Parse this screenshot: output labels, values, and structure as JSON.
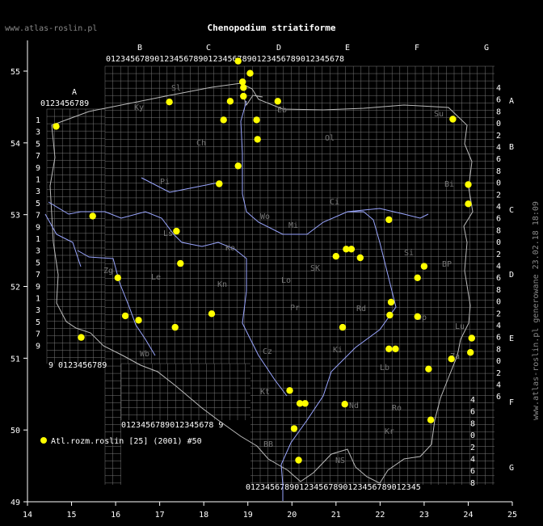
{
  "site_label": "www.atlas-roslin.pl",
  "title": "Chenopodium striatiforme",
  "generated": "www.atlas-roslin.pl generowane 23.02.18 18:09",
  "legend": {
    "label": "Atl.rozm.roslin [25] (2001) #50",
    "color": "#ffff00"
  },
  "colors": {
    "background": "#000000",
    "grid": "#777777",
    "border": "#bbbbbb",
    "rivers": "#9aa6ff",
    "points": "#ffff00"
  },
  "axes": {
    "lon_ticks": [
      "14",
      "15",
      "16",
      "17",
      "18",
      "19",
      "20",
      "21",
      "22",
      "23",
      "24",
      "25"
    ],
    "lat_ticks": [
      "55",
      "54",
      "53",
      "52",
      "51",
      "50",
      "49"
    ]
  },
  "grid_letters": {
    "top": [
      "A",
      "B",
      "C",
      "D",
      "E",
      "F",
      "G"
    ],
    "right": [
      "A",
      "B",
      "C",
      "D",
      "E",
      "F",
      "G"
    ]
  },
  "grid_digits": {
    "top_row": "0123456789012345678901234567890123456789012345678",
    "a_row": "0123456789",
    "left_col": [
      "1",
      "3",
      "5",
      "7",
      "9",
      "1",
      "3",
      "5",
      "7",
      "9",
      "1",
      "3",
      "5",
      "7",
      "9",
      "1",
      "3",
      "5",
      "7",
      "9"
    ],
    "right_col": [
      "4",
      "6",
      "8",
      "0",
      "2",
      "4",
      "6",
      "8",
      "0",
      "2",
      "4",
      "6",
      "8",
      "0",
      "2",
      "4",
      "6",
      "8",
      "0",
      "2",
      "4",
      "6",
      "8",
      "0",
      "2",
      "4",
      "6"
    ],
    "bottom_left_row": "9 0123456789",
    "bottom_mid_row": "0123456789012345678 9",
    "bottom_row": "012345678901234567890123456789012345",
    "f_col": [
      "4",
      "6",
      "8",
      "0",
      "2",
      "4",
      "6",
      "8"
    ]
  },
  "regions": [
    "Sl",
    "Ky",
    "Ch",
    "Eb",
    "Ol",
    "Su",
    "Pi",
    "Bi",
    "Ci",
    "Wo",
    "Mi",
    "Ko",
    "Ls",
    "Zg",
    "Le",
    "Kn",
    "Lo",
    "SK",
    "Si",
    "BP",
    "Pr",
    "Rd",
    "Lb",
    "Ki",
    "Op",
    "Kt",
    "Cz",
    "Ro",
    "Za",
    "BB",
    "Kr",
    "Nd",
    "Wb",
    "Lu",
    "NS"
  ],
  "chart_data": {
    "type": "scatter",
    "series": [
      {
        "name": "Atl.rozm.roslin [25] (2001) #50",
        "points": [
          [
            14.65,
            54.23
          ],
          [
            15.48,
            52.98
          ],
          [
            15.22,
            51.29
          ],
          [
            16.05,
            52.12
          ],
          [
            16.22,
            51.59
          ],
          [
            16.52,
            51.53
          ],
          [
            17.22,
            54.57
          ],
          [
            17.38,
            52.77
          ],
          [
            17.47,
            52.32
          ],
          [
            17.35,
            51.43
          ],
          [
            18.18,
            51.62
          ],
          [
            18.35,
            53.43
          ],
          [
            18.45,
            54.32
          ],
          [
            18.6,
            54.58
          ],
          [
            18.78,
            55.14
          ],
          [
            18.88,
            54.85
          ],
          [
            18.9,
            54.77
          ],
          [
            18.9,
            54.65
          ],
          [
            19.05,
            54.97
          ],
          [
            19.2,
            54.32
          ],
          [
            19.22,
            54.05
          ],
          [
            18.78,
            53.68
          ],
          [
            19.68,
            54.58
          ],
          [
            21.0,
            52.42
          ],
          [
            21.23,
            52.52
          ],
          [
            21.35,
            52.52
          ],
          [
            21.55,
            52.4
          ],
          [
            22.2,
            52.93
          ],
          [
            22.25,
            51.78
          ],
          [
            22.22,
            51.6
          ],
          [
            22.85,
            51.58
          ],
          [
            22.85,
            52.12
          ],
          [
            23.0,
            52.28
          ],
          [
            23.65,
            54.33
          ],
          [
            24.0,
            53.42
          ],
          [
            24.0,
            53.15
          ],
          [
            24.08,
            51.28
          ],
          [
            24.05,
            51.08
          ],
          [
            23.62,
            50.99
          ],
          [
            22.2,
            51.13
          ],
          [
            22.35,
            51.13
          ],
          [
            23.1,
            50.85
          ],
          [
            21.15,
            51.43
          ],
          [
            19.95,
            50.55
          ],
          [
            20.18,
            50.37
          ],
          [
            20.3,
            50.37
          ],
          [
            21.2,
            50.36
          ],
          [
            20.05,
            50.02
          ],
          [
            23.15,
            50.14
          ],
          [
            20.15,
            49.58
          ]
        ]
      }
    ],
    "xlim": [
      14,
      25
    ],
    "ylim": [
      49,
      55.5
    ],
    "grid": true
  }
}
